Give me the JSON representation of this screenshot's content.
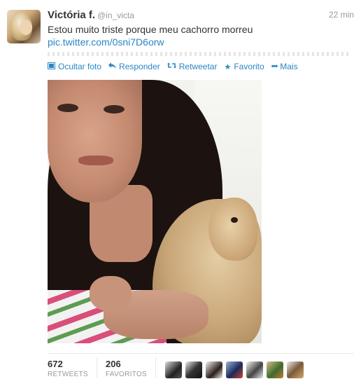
{
  "tweet": {
    "name": "Victória f.",
    "handle": "@in_victa",
    "time": "22 min",
    "text": "Estou muito triste porque meu cachorro morreu",
    "link": "pic.twitter.com/0sni7D6orw"
  },
  "actions": [
    {
      "label": "Ocultar foto",
      "icon": "photo-icon"
    },
    {
      "label": "Responder",
      "icon": "reply-icon"
    },
    {
      "label": "Retweetar",
      "icon": "retweet-icon"
    },
    {
      "label": "Favorito",
      "icon": "star-icon"
    },
    {
      "label": "Mais",
      "icon": "more-icon"
    }
  ],
  "stats": {
    "retweets": {
      "count": "672",
      "label": "RETWEETS"
    },
    "favorites": {
      "count": "206",
      "label": "FAVORITOS"
    }
  },
  "colors": {
    "link": "#2a86c6",
    "text": "#333333",
    "muted": "#999999"
  }
}
